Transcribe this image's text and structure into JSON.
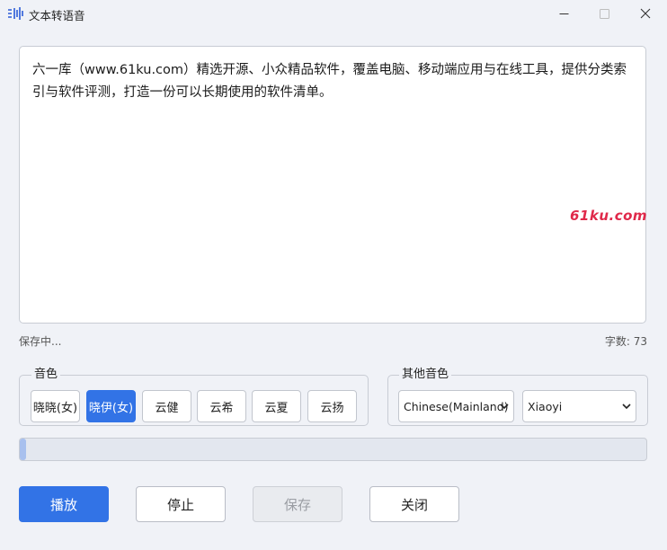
{
  "window": {
    "title": "文本转语音",
    "icon": "audio-wave-icon"
  },
  "editor": {
    "text": "六一库（www.61ku.com）精选开源、小众精品软件，覆盖电脑、移动端应用与在线工具，提供分类索引与软件评测，打造一份可以长期使用的软件清单。"
  },
  "watermark": "61ku.com",
  "status": {
    "text": "保存中...",
    "word_count_label": "字数: 73"
  },
  "voice_group": {
    "legend": "音色",
    "options": [
      "晓晓(女)",
      "晓伊(女)",
      "云健",
      "云希",
      "云夏",
      "云扬"
    ],
    "selected_index": 1
  },
  "other_voice_group": {
    "legend": "其他音色",
    "region_select": "Chinese(Mainland)",
    "voice_select": "Xiaoyi"
  },
  "progress": {
    "fraction": 0.01
  },
  "actions": {
    "play": "播放",
    "stop": "停止",
    "save": "保存",
    "close": "关闭"
  },
  "colors": {
    "accent": "#3273e6",
    "watermark": "#e0294a",
    "background": "#f0f2f7"
  }
}
